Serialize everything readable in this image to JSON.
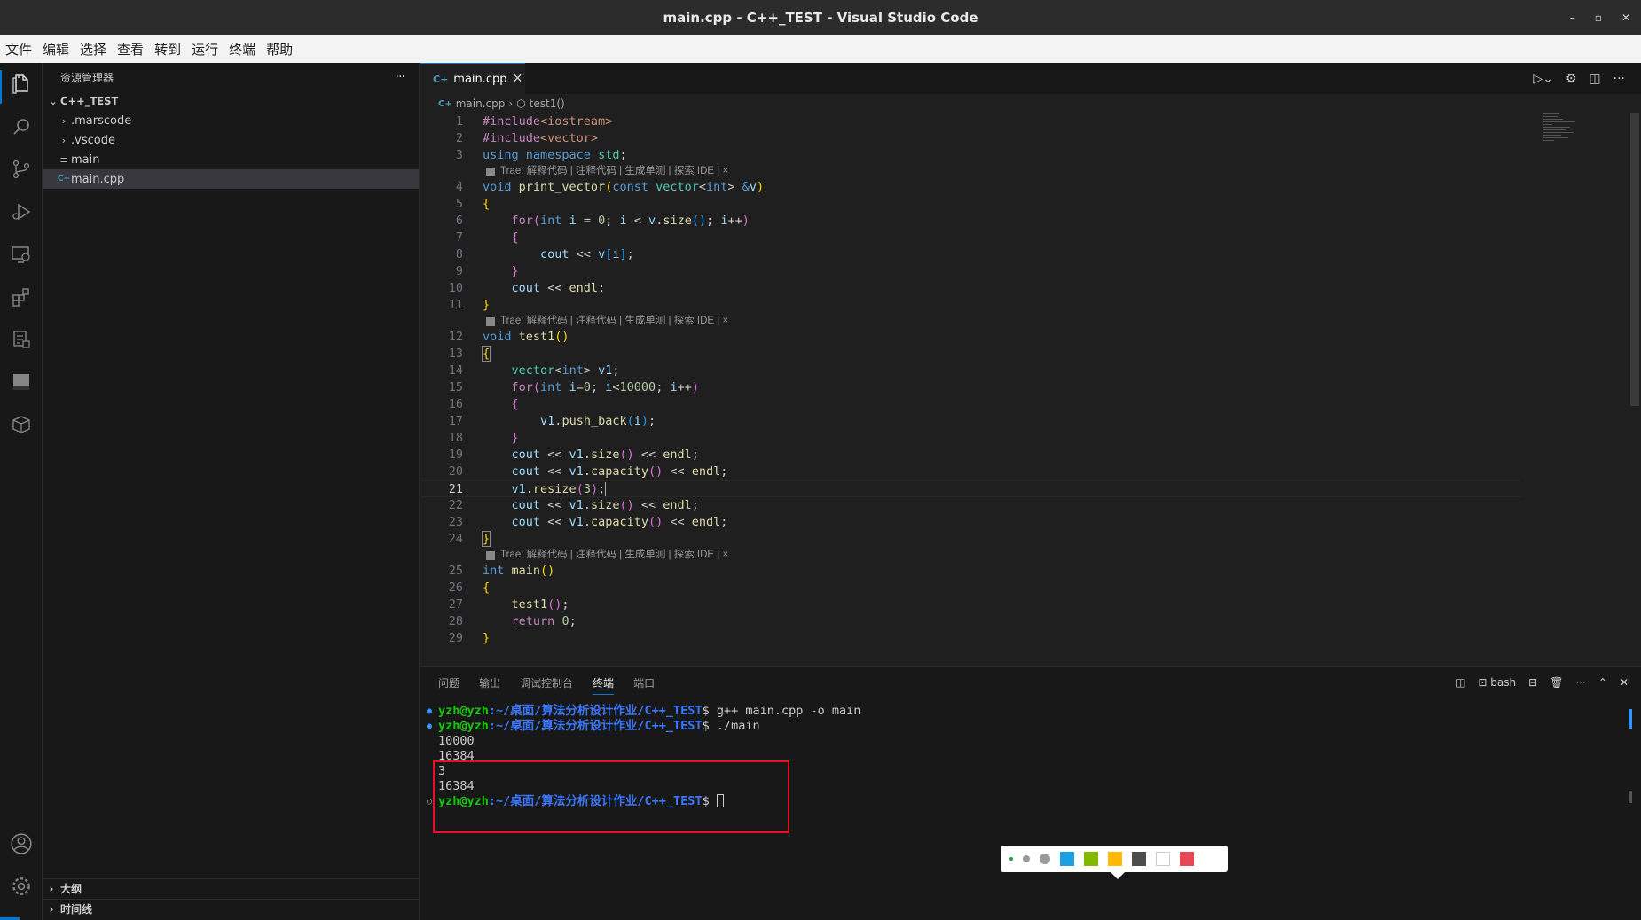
{
  "window": {
    "title": "main.cpp - C++_TEST - Visual Studio Code",
    "minimize": "–",
    "restore": "▫",
    "close": "✕"
  },
  "menu": [
    "文件",
    "编辑",
    "选择",
    "查看",
    "转到",
    "运行",
    "终端",
    "帮助"
  ],
  "activity_icons": [
    "files-icon",
    "search-icon",
    "source-control-icon",
    "run-debug-icon",
    "remote-explorer-icon",
    "extensions-icon",
    "testing-icon",
    "panel-icon",
    "package-icon",
    "account-icon",
    "settings-gear-icon"
  ],
  "sidebar": {
    "title": "资源管理器",
    "more": "···",
    "project": "C++_TEST",
    "items": [
      {
        "label": ".marscode",
        "kind": "folder",
        "chevron": "›"
      },
      {
        "label": ".vscode",
        "kind": "folder",
        "chevron": "›"
      },
      {
        "label": "main",
        "kind": "file",
        "chevron": "≡"
      },
      {
        "label": "main.cpp",
        "kind": "cpp",
        "chevron": "C+"
      }
    ],
    "outline": "大纲",
    "timeline": "时间线"
  },
  "editor": {
    "tab_label": "main.cpp",
    "tab_icon": "C+",
    "tab_close": "✕",
    "breadcrumb_file": "main.cpp",
    "breadcrumb_sep": "›",
    "breadcrumb_symbol": "test1()",
    "codelens": "Trae: 解释代码 | 注释代码 | 生成单测 | 探索 IDE | ×",
    "current_line": 21
  },
  "panel": {
    "tabs": [
      "问题",
      "输出",
      "调试控制台",
      "终端",
      "端口"
    ],
    "active_tab": "终端",
    "shell": "bash",
    "actions": {
      "layout": "◫",
      "split": "⊟",
      "trash": "🗑",
      "more": "···",
      "maximize": "⌃",
      "close": "✕"
    },
    "prompt_user": "yzh@yzh",
    "prompt_path": ":~/桌面/算法分析设计作业/C++_TEST",
    "prompt_symbol": "$",
    "cmd1": " g++ main.cpp -o main",
    "cmd2": " ./main",
    "outputs": [
      "10000",
      "16384",
      "3",
      "16384"
    ]
  },
  "colors": {
    "accent": "#0078d4",
    "highlight_box": "#e81123",
    "swatches": [
      "#1ba1e2",
      "#7fba00",
      "#ffb900",
      "#4d4d4d",
      "#ffffff",
      "#e74856"
    ]
  }
}
